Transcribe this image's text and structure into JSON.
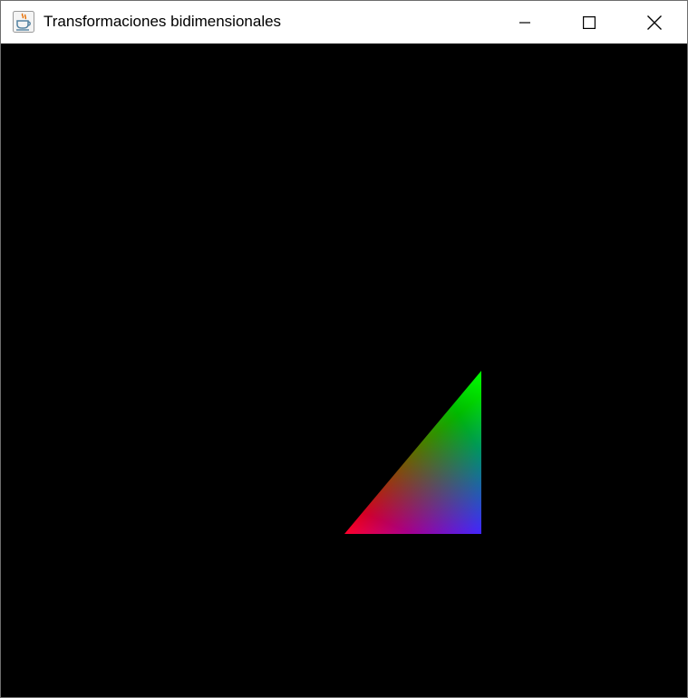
{
  "window": {
    "title": "Transformaciones bidimensionales",
    "icon": "java-coffee-cup-icon"
  },
  "controls": {
    "minimize_icon": "minimize-icon",
    "maximize_icon": "maximize-icon",
    "close_icon": "close-icon"
  },
  "canvas": {
    "background": "#000000",
    "triangle": {
      "vertex_colors": [
        "#ff0000",
        "#00ff00",
        "#0000ff"
      ]
    }
  }
}
